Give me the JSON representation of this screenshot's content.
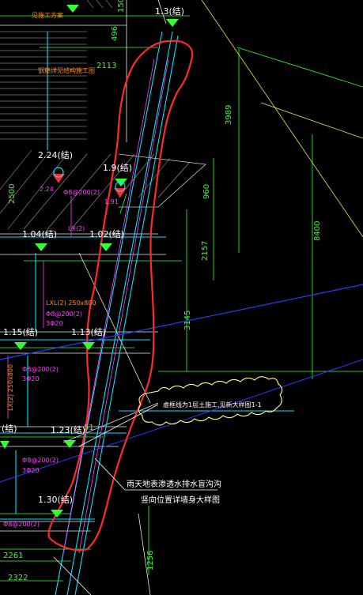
{
  "colors": {
    "background": "#000000",
    "markup_cloud_red": "#ff2a2a",
    "dimension_green": "#33ff33",
    "wall_cyan": "#00e5ff",
    "rebar_magenta": "#ff40ff",
    "text_orange": "#ff8a1e",
    "axis_blue": "#2e3cff",
    "leader_yellow": "#ffff66",
    "annotation_cloud_yellow": "#ffff80"
  },
  "elevations": {
    "e_top": "1.3(结)",
    "e_224": "2.24(结)",
    "e_191": "1.9(结)",
    "e_104": "1.04(结)",
    "e_102": "1.02(结)",
    "e_115": "1.15(结)",
    "e_113": "1.13(结)",
    "e_left": "(结)",
    "e_123": "1.23(结)",
    "e_130": "1.30(结)"
  },
  "dimensions": {
    "d_2113": "2113",
    "d_3989": "3989",
    "d_2500": "2500",
    "d_960": "960",
    "d_2157": "2157",
    "d_8400": "8400",
    "d_3145": "3145",
    "d_2261": "2261",
    "d_2322": "2322",
    "d_1256": "1256",
    "d_496": "496",
    "d_150": "150",
    "d_51": "51"
  },
  "labels": {
    "beam_250x800": "LXL(2) 250x800",
    "beam_250x800_b": "LX(2) 250x800",
    "rebar_a": "Φ8@200(2)",
    "rebar_b": "3Φ20",
    "small_note": "钢筋详见结构施工图",
    "lx_note": "LX(2)",
    "top_left_note": "见施工方案",
    "red_axis_1": "2.24",
    "red_axis_2": "1.91"
  },
  "annotations": {
    "cloud_note": "虚框线为1层土施工,见新大样图1-1",
    "rain_note_line1": "雨天地表渗透水排水盲沟沟",
    "rain_note_line2": "竖向位置详墙身大样图"
  }
}
